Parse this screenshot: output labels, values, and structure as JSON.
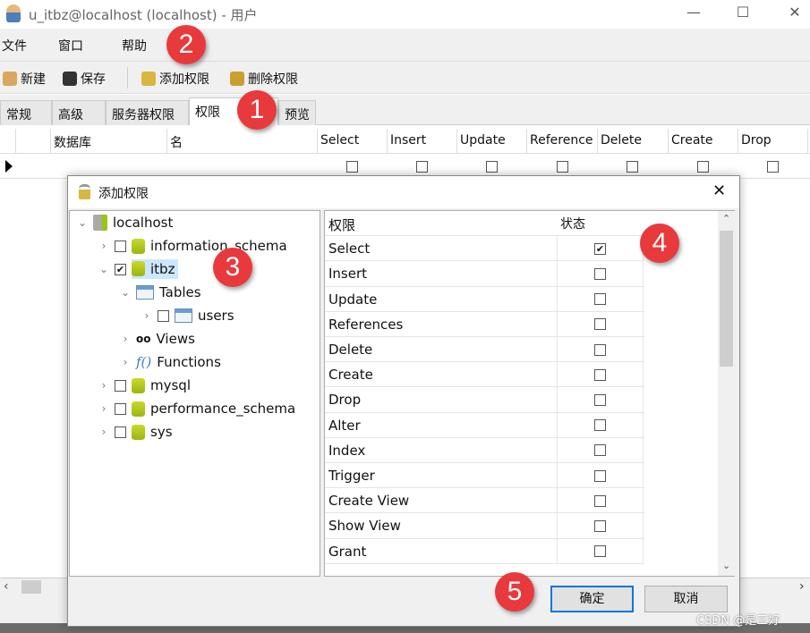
{
  "window": {
    "title": "u_itbz@localhost (localhost) - 用户",
    "minimize": "—",
    "maximize": "☐",
    "close": "✕"
  },
  "menu": [
    "文件",
    "窗口",
    "帮助"
  ],
  "toolbar": {
    "new": "新建",
    "save": "保存",
    "add_priv": "添加权限",
    "del_priv": "删除权限"
  },
  "tabs": [
    "常规",
    "高级",
    "服务器权限",
    "权限",
    "预览"
  ],
  "grid": {
    "columns": [
      "数据库",
      "名",
      "Select",
      "Insert",
      "Update",
      "Reference",
      "Delete",
      "Create",
      "Drop"
    ]
  },
  "dialog": {
    "title": "添加权限",
    "tree": {
      "root": "localhost",
      "items": [
        {
          "label": "information_schema",
          "checked": false
        },
        {
          "label": "itbz",
          "checked": true,
          "selected": true
        },
        {
          "label": "Tables"
        },
        {
          "label": "users",
          "checked": false
        },
        {
          "label": "Views"
        },
        {
          "label": "Functions"
        },
        {
          "label": "mysql",
          "checked": false
        },
        {
          "label": "performance_schema",
          "checked": false
        },
        {
          "label": "sys",
          "checked": false
        }
      ]
    },
    "perm_header": {
      "name": "权限",
      "status": "状态"
    },
    "permissions": [
      {
        "name": "Select",
        "checked": true
      },
      {
        "name": "Insert",
        "checked": false
      },
      {
        "name": "Update",
        "checked": false
      },
      {
        "name": "References",
        "checked": false
      },
      {
        "name": "Delete",
        "checked": false
      },
      {
        "name": "Create",
        "checked": false
      },
      {
        "name": "Drop",
        "checked": false
      },
      {
        "name": "Alter",
        "checked": false
      },
      {
        "name": "Index",
        "checked": false
      },
      {
        "name": "Trigger",
        "checked": false
      },
      {
        "name": "Create View",
        "checked": false
      },
      {
        "name": "Show View",
        "checked": false
      },
      {
        "name": "Grant",
        "checked": false
      }
    ],
    "ok": "确定",
    "cancel": "取消"
  },
  "markers": [
    "1",
    "2",
    "3",
    "4",
    "5"
  ],
  "watermark": "CSDN @是三好",
  "colors": {
    "marker": "#e8393c",
    "selection": "#cce8ff",
    "db_icon": "#b5c81e"
  }
}
